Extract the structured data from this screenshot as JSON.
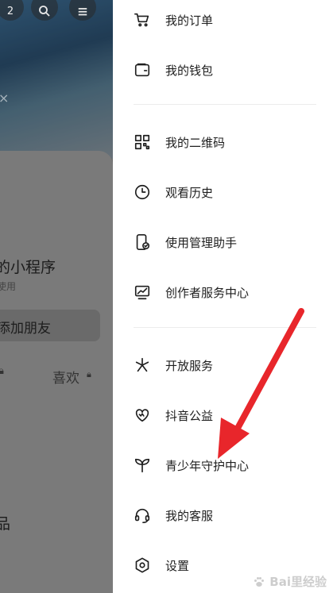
{
  "background_page": {
    "banner_mark": "×",
    "top_buttons": [
      {
        "icon": "badge-count-icon",
        "text": "2"
      },
      {
        "icon": "search-icon"
      },
      {
        "icon": "menu-icon"
      }
    ],
    "mini_program_title": "的小程序",
    "mini_program_sub": "使用",
    "add_friend_label": "添加朋友",
    "tab_like_label": "喜欢",
    "bottom_text": "品"
  },
  "drawer": {
    "items": [
      {
        "label": "我的订单",
        "icon": "shopping-cart-icon"
      },
      {
        "label": "我的钱包",
        "icon": "wallet-icon"
      },
      {
        "label": "我的二维码",
        "icon": "qr-code-icon"
      },
      {
        "label": "观看历史",
        "icon": "clock-icon"
      },
      {
        "label": "使用管理助手",
        "icon": "phone-check-icon"
      },
      {
        "label": "创作者服务中心",
        "icon": "monitor-chart-icon"
      },
      {
        "label": "开放服务",
        "icon": "asterisk-icon"
      },
      {
        "label": "抖音公益",
        "icon": "heart-hands-icon"
      },
      {
        "label": "青少年守护中心",
        "icon": "sprout-icon"
      },
      {
        "label": "我的客服",
        "icon": "headset-icon"
      },
      {
        "label": "设置",
        "icon": "settings-icon"
      }
    ]
  },
  "annotation": {
    "color": "#e8262b"
  },
  "watermark": {
    "text": "Bai里经验"
  }
}
